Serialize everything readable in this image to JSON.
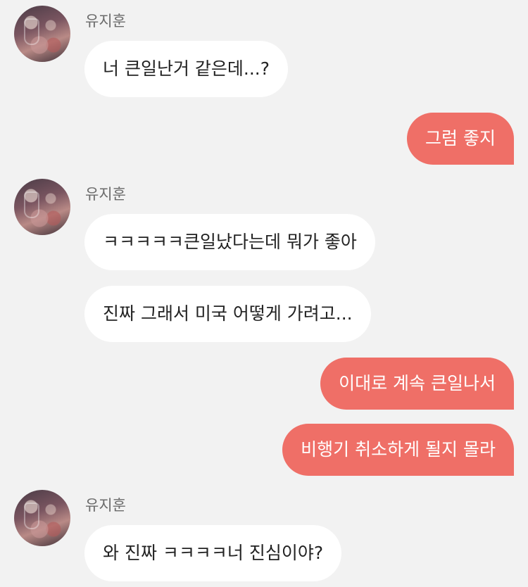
{
  "conversation": {
    "contact_name": "유지훈",
    "messages": [
      {
        "from": "유지훈",
        "text": "너 큰일난거 같은데...?"
      },
      {
        "from": "me",
        "text": "그럼 좋지"
      },
      {
        "from": "유지훈",
        "text": "ㅋㅋㅋㅋㅋ큰일났다는데 뭐가 좋아"
      },
      {
        "from": "유지훈",
        "text": "진짜 그래서 미국 어떻게 가려고..."
      },
      {
        "from": "me",
        "text": "이대로 계속 큰일나서"
      },
      {
        "from": "me",
        "text": "비행기 취소하게 될지 몰라"
      },
      {
        "from": "유지훈",
        "text": "와 진짜 ㅋㅋㅋㅋ너 진심이야?"
      }
    ]
  },
  "colors": {
    "background": "#f2f2f2",
    "incoming_bubble": "#ffffff",
    "outgoing_bubble": "#ef6f67"
  }
}
